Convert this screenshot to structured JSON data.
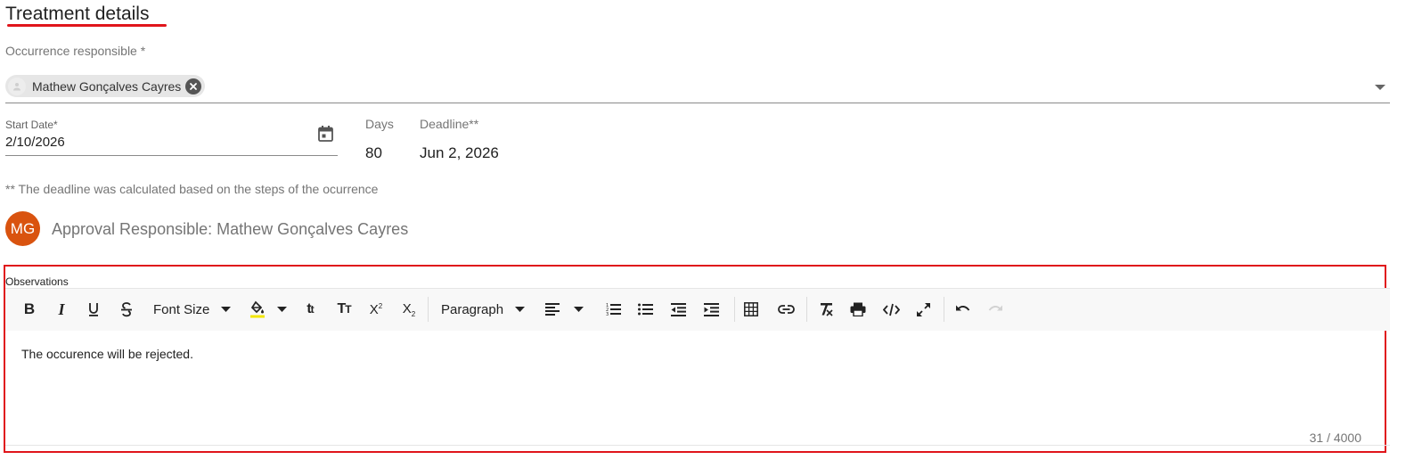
{
  "section": {
    "title": "Treatment details"
  },
  "responsible": {
    "label": "Occurrence responsible *",
    "chip_name": "Mathew Gonçalves Cayres"
  },
  "start_date": {
    "label": "Start Date*",
    "value": "2/10/2026"
  },
  "days": {
    "label": "Days",
    "value": "80"
  },
  "deadline": {
    "label": "Deadline**",
    "value": "Jun 2, 2026"
  },
  "note": "** The deadline was calculated based on the steps of the ocurrence",
  "approval": {
    "initials": "MG",
    "text": "Approval Responsible: Mathew Gonçalves Cayres",
    "avatar_color": "#d9530f"
  },
  "observations": {
    "label": "Observations",
    "toolbar": {
      "font_size_label": "Font Size",
      "paragraph_label": "Paragraph",
      "buttons": [
        "bold-icon",
        "italic-icon",
        "underline-icon",
        "strikethrough-icon",
        "fill-color-icon",
        "lowercase-icon",
        "uppercase-icon",
        "superscript-icon",
        "subscript-icon",
        "align-left-icon",
        "ordered-list-icon",
        "unordered-list-icon",
        "outdent-icon",
        "indent-icon",
        "table-icon",
        "link-icon",
        "clear-format-icon",
        "print-icon",
        "code-view-icon",
        "fullscreen-icon",
        "undo-icon",
        "redo-icon"
      ]
    },
    "content": "The occurence will be rejected.",
    "counter": "31 / 4000"
  },
  "colors": {
    "highlight_red": "#e0151b",
    "fill_color_swatch": "#f2e600"
  }
}
